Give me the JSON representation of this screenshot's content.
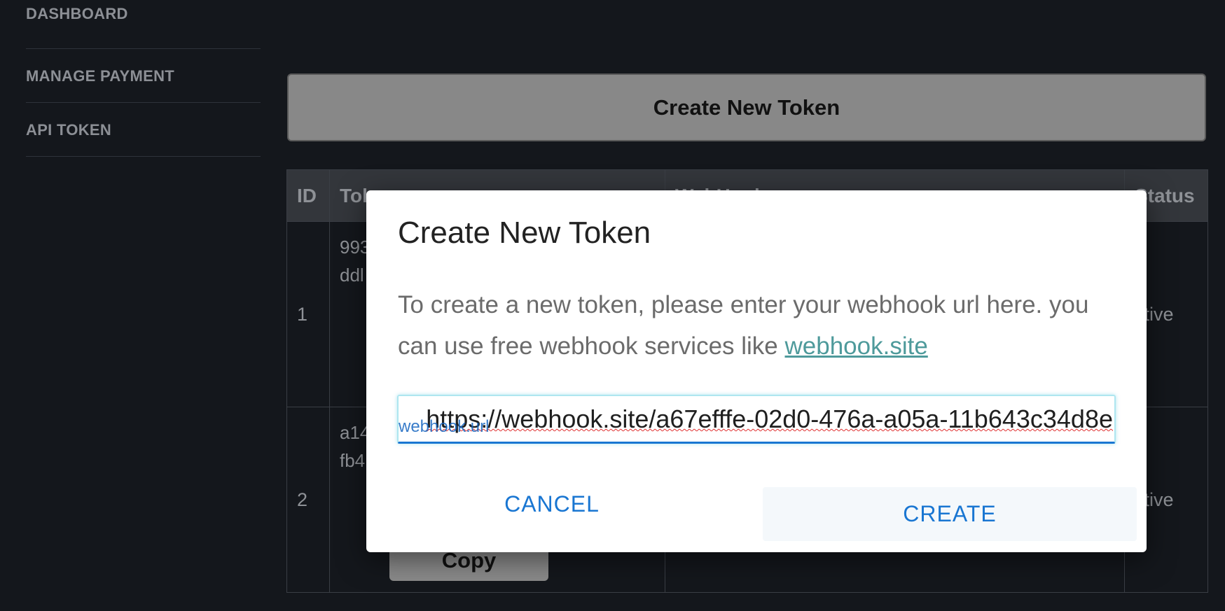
{
  "sidebar": {
    "items": [
      {
        "label": "DASHBOARD"
      },
      {
        "label": "MANAGE PAYMENT"
      },
      {
        "label": "API TOKEN"
      }
    ]
  },
  "main": {
    "create_button_label": "Create New Token",
    "table": {
      "headers": [
        "ID",
        "Tok",
        "WebHook",
        "Status"
      ],
      "rows": [
        {
          "id": "1",
          "token_lines": [
            "993",
            "ddl"
          ],
          "status": "ctive"
        },
        {
          "id": "2",
          "token_lines": [
            "a14",
            "fb4"
          ],
          "status": "ctive",
          "copy_label": "Copy"
        }
      ]
    }
  },
  "dialog": {
    "title": "Create New Token",
    "body_text": "To create a new token, please enter your webhook url here. you can use free webhook services like ",
    "link_text": "webhook.site",
    "url_value": "https://webhook.site/a67efffe-02d0-476a-a05a-11b643c34d8e",
    "url_overlay_label": "webhook.url",
    "cancel_label": "CANCEL",
    "create_label": "CREATE"
  }
}
